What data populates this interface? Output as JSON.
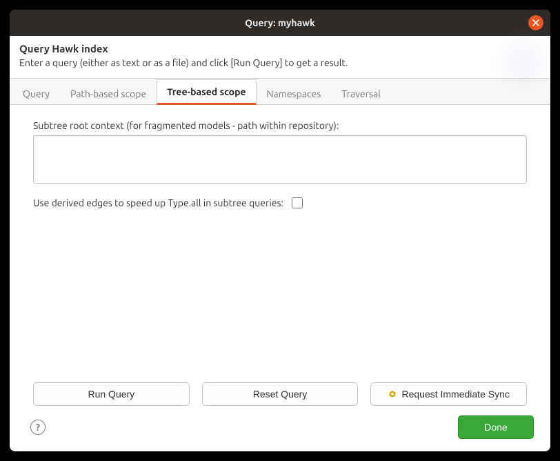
{
  "window": {
    "title": "Query: myhawk"
  },
  "header": {
    "heading": "Query Hawk index",
    "description": "Enter a query (either as text or as a file) and click [Run Query] to get a result."
  },
  "tabs": [
    {
      "label": "Query",
      "active": false
    },
    {
      "label": "Path-based scope",
      "active": false
    },
    {
      "label": "Tree-based scope",
      "active": true
    },
    {
      "label": "Namespaces",
      "active": false
    },
    {
      "label": "Traversal",
      "active": false
    }
  ],
  "tree_scope": {
    "root_label": "Subtree root context (for fragmented models - path within repository):",
    "root_value": "",
    "derived_label": "Use derived edges to speed up Type.all in subtree queries:",
    "derived_checked": false
  },
  "buttons": {
    "run": "Run Query",
    "reset": "Reset Query",
    "sync": "Request Immediate Sync",
    "done": "Done"
  },
  "icons": {
    "sync_color": "#d9a400"
  }
}
